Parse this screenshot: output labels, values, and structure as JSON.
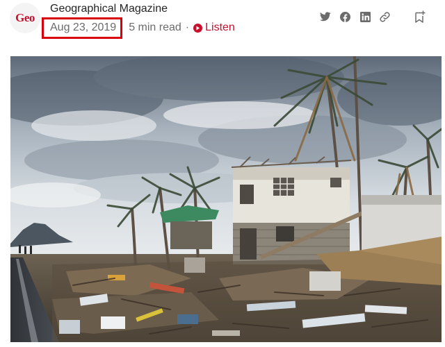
{
  "article": {
    "publication": "Geographical Magazine",
    "logo_text": "Geo",
    "date": "Aug 23, 2019",
    "read_time": "5 min read",
    "separator": "·",
    "listen_label": "Listen"
  },
  "share": {
    "icons": [
      "twitter-icon",
      "facebook-icon",
      "linkedin-icon",
      "link-icon",
      "bookmark-icon"
    ]
  },
  "colors": {
    "accent": "#c8102e",
    "highlight_box": "#d9000d",
    "meta_text": "#6b6b6b",
    "icon_gray": "#6b6b6b"
  }
}
